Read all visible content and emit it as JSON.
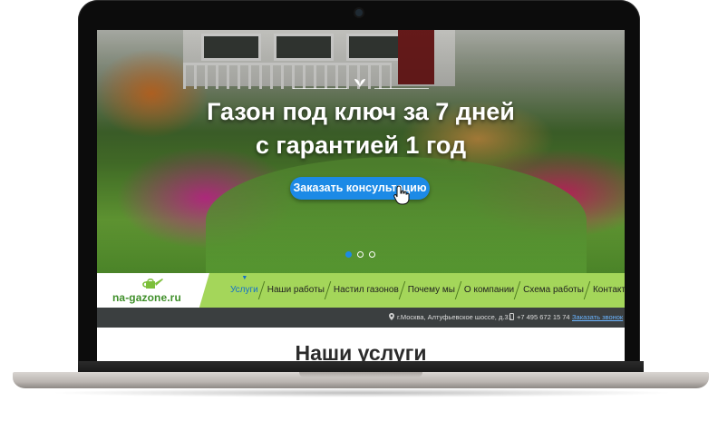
{
  "device": {
    "brand_label": "MacBook"
  },
  "hero": {
    "title_line1": "Газон под ключ за 7 дней",
    "title_line2": "с гарантией 1 год",
    "cta_label": "Заказать консультацию",
    "slides": {
      "count": 3,
      "active_index": 0
    }
  },
  "logo": {
    "text": "na-gazone.ru"
  },
  "nav": {
    "items": [
      {
        "label": "Услуги",
        "active": true
      },
      {
        "label": "Наши работы",
        "active": false
      },
      {
        "label": "Настил газонов",
        "active": false
      },
      {
        "label": "Почему мы",
        "active": false
      },
      {
        "label": "О компании",
        "active": false
      },
      {
        "label": "Схема работы",
        "active": false
      },
      {
        "label": "Контакты",
        "active": false
      }
    ]
  },
  "infobar": {
    "address": "г.Москва, Алтуфьевское шоссе, д.31",
    "phone": "+7 495 672 15 74",
    "callback_label": "Заказать звонок"
  },
  "content": {
    "section_title": "Наши услуги"
  },
  "colors": {
    "accent_green": "#a4d65a",
    "cta_blue": "#1c8ae6",
    "infobar_bg": "#3b3f40",
    "logo_green": "#3f8f2a"
  },
  "icons": {
    "logo": "watering-can-icon",
    "address": "map-pin-icon",
    "phone": "phone-icon",
    "cursor": "hand-pointer-icon",
    "decor": "leaf-icon"
  }
}
